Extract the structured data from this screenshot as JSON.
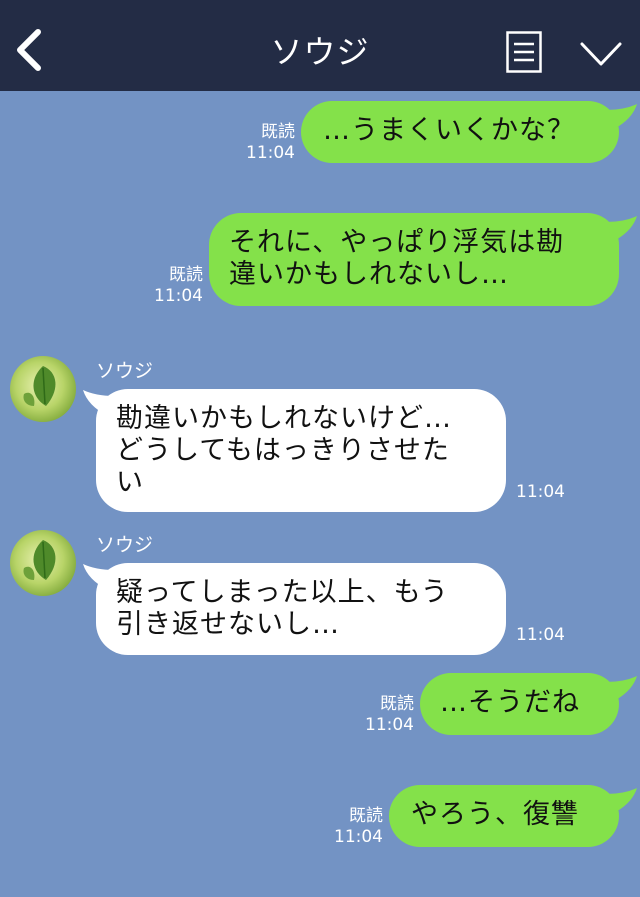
{
  "header": {
    "title": "ソウジ"
  },
  "messages": [
    {
      "type": "sent",
      "text": "…うまくいくかな？",
      "read": "既読",
      "time": "11:04"
    },
    {
      "type": "sent",
      "lines": [
        "それに、やっぱり浮気は勘",
        "違いかもしれないし…"
      ],
      "read": "既読",
      "time": "11:04"
    },
    {
      "type": "received",
      "sender": "ソウジ",
      "lines": [
        "勘違いかもしれないけど…",
        "どうしてもはっきりさせた",
        "い"
      ],
      "time": "11:04"
    },
    {
      "type": "received",
      "sender": "ソウジ",
      "lines": [
        "疑ってしまった以上、もう",
        "引き返せないし…"
      ],
      "time": "11:04"
    },
    {
      "type": "sent",
      "text": "…そうだね",
      "read": "既読",
      "time": "11:04"
    },
    {
      "type": "sent",
      "text": "やろう、復讐",
      "read": "既読",
      "time": "11:04"
    }
  ],
  "colors": {
    "header_bg": "#232c45",
    "chat_bg": "#7393c4",
    "sent_bubble": "#84e14a",
    "received_bubble": "#ffffff"
  },
  "icons": [
    "back-arrow-icon",
    "memo-icon",
    "chevron-down-icon",
    "avatar-leaf"
  ]
}
